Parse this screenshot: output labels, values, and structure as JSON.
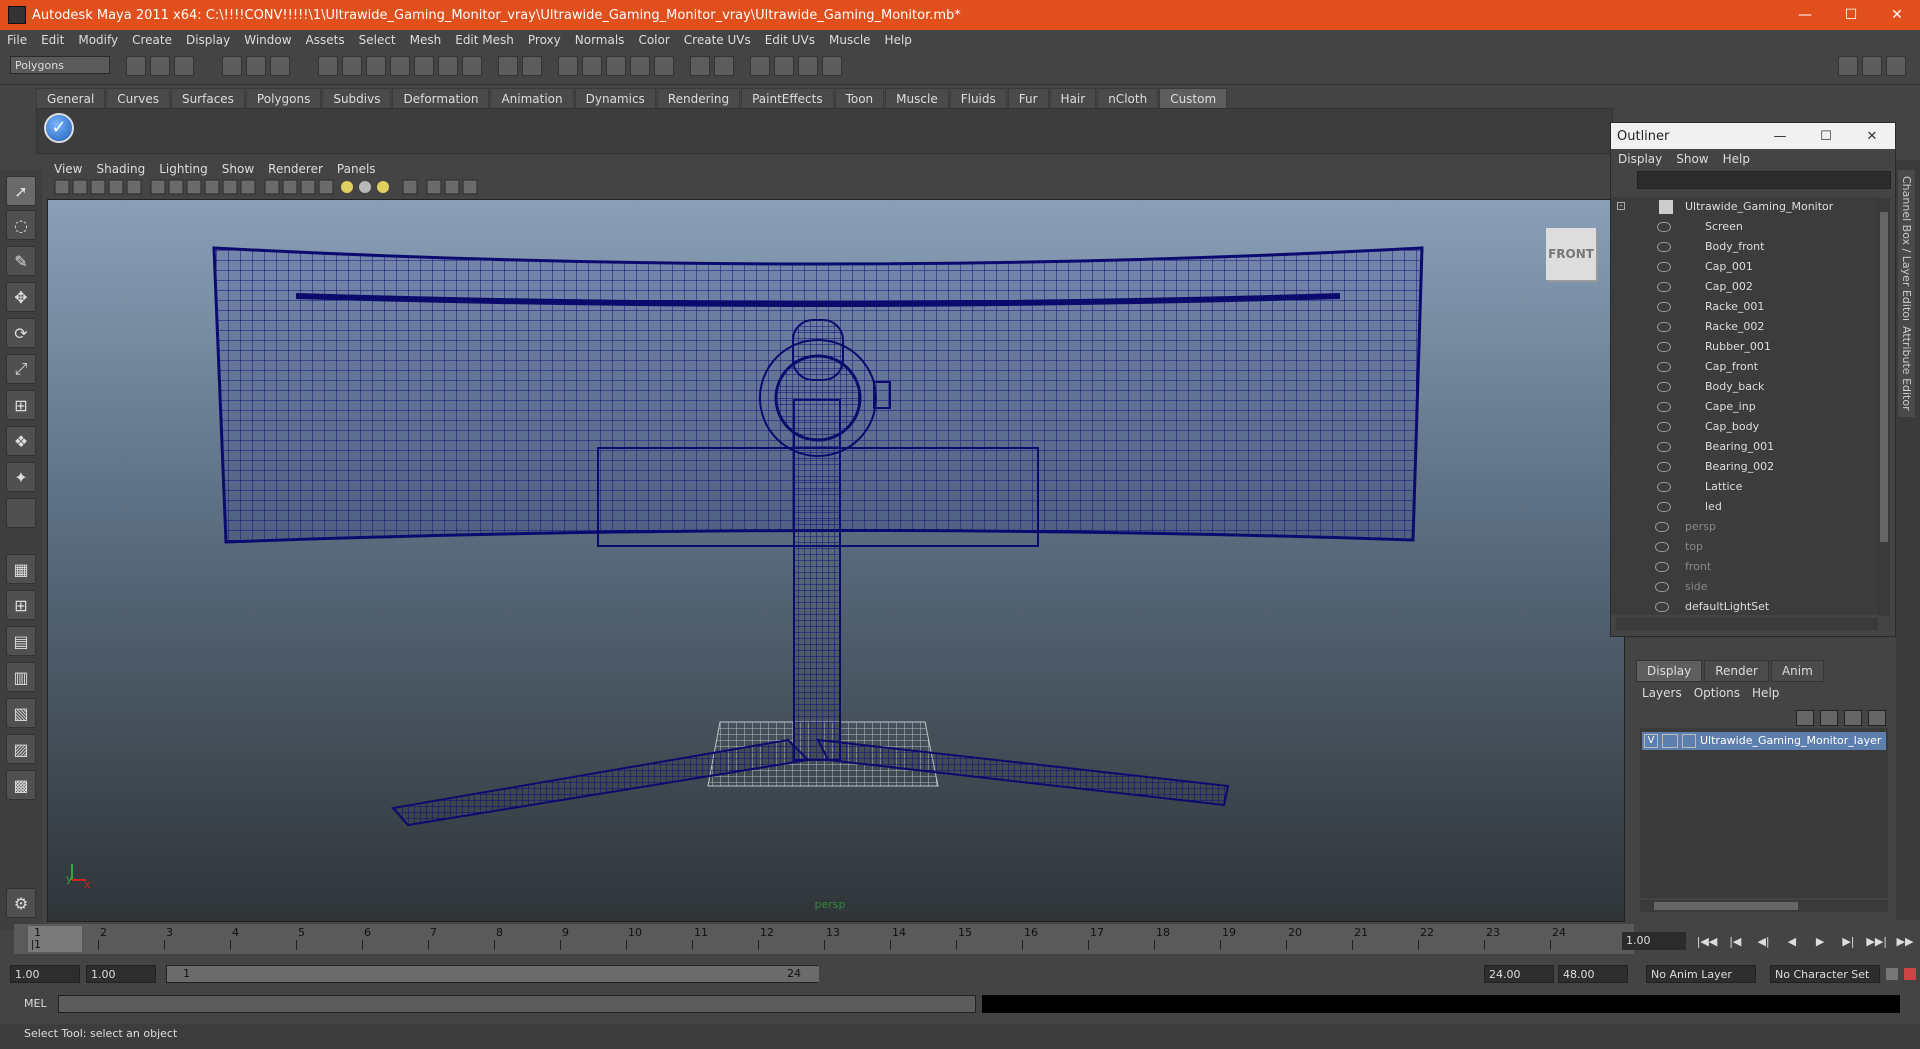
{
  "window": {
    "title": "Autodesk Maya 2011 x64: C:\\!!!!CONV!!!!!\\1\\Ultrawide_Gaming_Monitor_vray\\Ultrawide_Gaming_Monitor_vray\\Ultrawide_Gaming_Monitor.mb*",
    "minimize": "—",
    "maximize": "☐",
    "close": "✕"
  },
  "menubar": [
    "File",
    "Edit",
    "Modify",
    "Create",
    "Display",
    "Window",
    "Assets",
    "Select",
    "Mesh",
    "Edit Mesh",
    "Proxy",
    "Normals",
    "Color",
    "Create UVs",
    "Edit UVs",
    "Muscle",
    "Help"
  ],
  "mode_selector": "Polygons",
  "shelf": {
    "tabs": [
      "General",
      "Curves",
      "Surfaces",
      "Polygons",
      "Subdivs",
      "Deformation",
      "Animation",
      "Dynamics",
      "Rendering",
      "PaintEffects",
      "Toon",
      "Muscle",
      "Fluids",
      "Fur",
      "Hair",
      "nCloth",
      "Custom"
    ],
    "active_tab": "Custom",
    "button_icon": "check-circle-icon"
  },
  "panel_menu": [
    "View",
    "Shading",
    "Lighting",
    "Show",
    "Renderer",
    "Panels"
  ],
  "viewport": {
    "view_cube": "FRONT",
    "camera": "persp",
    "axis_y": "y",
    "axis_x": "x"
  },
  "outliner": {
    "title": "Outliner",
    "menu": [
      "Display",
      "Show",
      "Help"
    ],
    "root": "Ultrawide_Gaming_Monitor",
    "children": [
      "Screen",
      "Body_front",
      "Cap_001",
      "Cap_002",
      "Racke_001",
      "Racke_002",
      "Rubber_001",
      "Cap_front",
      "Body_back",
      "Cape_inp",
      "Cap_body",
      "Bearing_001",
      "Bearing_002",
      "Lattice",
      "led"
    ],
    "cameras": [
      "persp",
      "top",
      "front",
      "side"
    ],
    "sets": [
      "defaultLightSet"
    ]
  },
  "side_tabs": [
    "Channel Box / Layer Editor",
    "Attribute Editor"
  ],
  "layer_editor": {
    "tabs": [
      "Display",
      "Render",
      "Anim"
    ],
    "active_tab": "Display",
    "menu": [
      "Layers",
      "Options",
      "Help"
    ],
    "layer": {
      "visible": "V",
      "name": "Ultrawide_Gaming_Monitor_layer"
    }
  },
  "time_slider": {
    "ticks": [
      "1",
      "2",
      "3",
      "4",
      "5",
      "6",
      "7",
      "8",
      "9",
      "10",
      "11",
      "12",
      "13",
      "14",
      "15",
      "16",
      "17",
      "18",
      "19",
      "20",
      "21",
      "22",
      "23",
      "24"
    ],
    "current_frame": "1",
    "current_time_field": "1.00"
  },
  "playback_buttons": [
    "|◀◀",
    "|◀",
    "◀|",
    "◀",
    "▶",
    "▶|",
    "▶▶|",
    "▶▶"
  ],
  "range": {
    "start_time": "1.00",
    "playback_start": "1.00",
    "slider_start": "1",
    "slider_end": "24",
    "playback_end": "24.00",
    "end_time": "48.00",
    "anim_layer": "No Anim Layer",
    "character_set": "No Character Set"
  },
  "command_line": {
    "label": "MEL"
  },
  "help_line": "Select Tool: select an object",
  "colors": {
    "title_bar": "#e14f1d",
    "wireframe": "#0d0d7a",
    "layer_highlight": "#5d7fae"
  }
}
